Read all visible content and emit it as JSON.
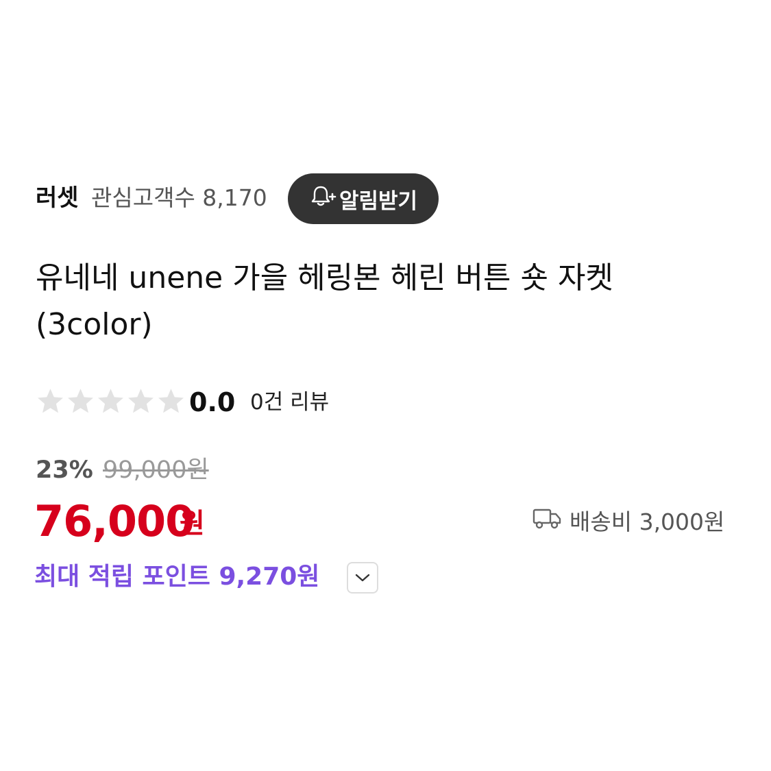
{
  "seller": {
    "name": "러셋",
    "followers_text": "관심고객수 8,170",
    "alarm_label": "알림받기"
  },
  "product": {
    "title": "유네네 unene 가을 헤링본 헤린 버튼 숏 자켓 (3color)"
  },
  "rating": {
    "stars_filled": 0,
    "stars_total": 5,
    "score": "0.0",
    "review_count": "0건 리뷰"
  },
  "price": {
    "discount": "23%",
    "original": "99,000원",
    "sale": "76,000",
    "currency": "원",
    "shipping": "배송비 3,000원",
    "points": "최대 적립 포인트 9,270원"
  },
  "colors": {
    "sale_price": "#d6001c",
    "points": "#7b4fe0",
    "alarm_button_bg": "#333333",
    "star_empty": "#e2e2e2"
  },
  "icons": {
    "alarm": "bell-plus-icon",
    "shipping": "truck-icon",
    "points_toggle": "chevron-down-icon",
    "star": "star-icon"
  }
}
